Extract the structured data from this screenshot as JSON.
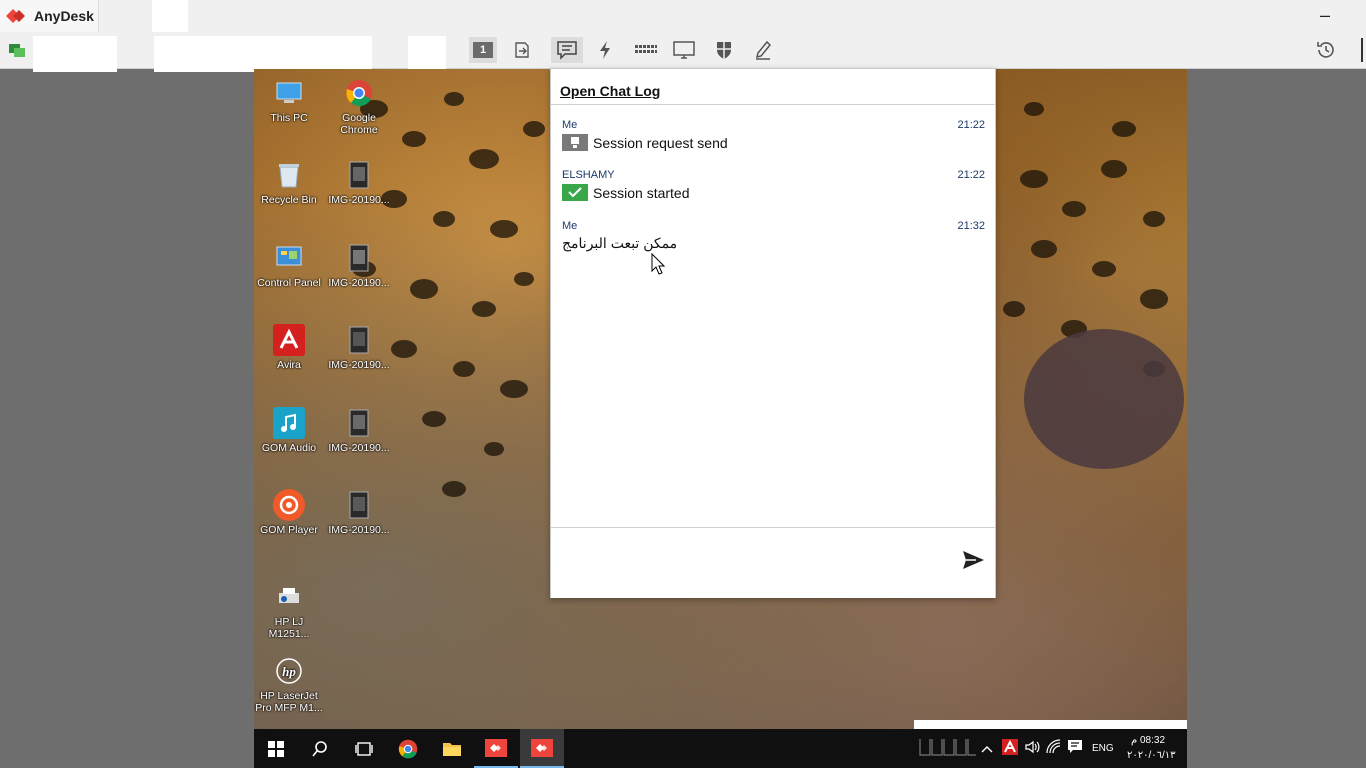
{
  "app": {
    "title": "AnyDesk",
    "minimize_glyph": "–"
  },
  "toolbar": {
    "display_number": "1",
    "icons": [
      "monitor-select-icon",
      "file-transfer-icon",
      "chat-icon",
      "actions-lightning-icon",
      "keyboard-icon",
      "display-icon",
      "permissions-shield-icon",
      "whiteboard-pen-icon",
      "history-icon"
    ]
  },
  "remote": {
    "desktop_icons": [
      {
        "label": "This PC"
      },
      {
        "label": "Google Chrome"
      },
      {
        "label": "Recycle Bin"
      },
      {
        "label": "IMG-20190..."
      },
      {
        "label": "Control Panel"
      },
      {
        "label": "IMG-20190..."
      },
      {
        "label": "Avira"
      },
      {
        "label": "IMG-20190..."
      },
      {
        "label": "GOM Audio"
      },
      {
        "label": "IMG-20190..."
      },
      {
        "label": "GOM Player"
      },
      {
        "label": "IMG-20190..."
      },
      {
        "label": "HP LJ M1251..."
      },
      {
        "label": "HP LaserJet Pro MFP M1..."
      }
    ],
    "tray": {
      "language": "ENG",
      "time": "08:32 م",
      "date": "٢٠٢٠/٠٦/١٣"
    }
  },
  "chat": {
    "header_link": "Open Chat Log",
    "messages": [
      {
        "sender": "Me",
        "time": "21:22",
        "text": "Session request send",
        "icon": "session-request-icon"
      },
      {
        "sender": "ELSHAMY",
        "time": "21:22",
        "text": "Session started",
        "icon": "session-started-icon"
      },
      {
        "sender": "Me",
        "time": "21:32",
        "text": "ممكن تبعت البرنامج"
      }
    ],
    "input_value": "",
    "send_icon": "send-icon"
  },
  "colors": {
    "accent": "#ef443b",
    "session_started": "#3aa64a",
    "sender_blue": "#1a3a6a"
  }
}
